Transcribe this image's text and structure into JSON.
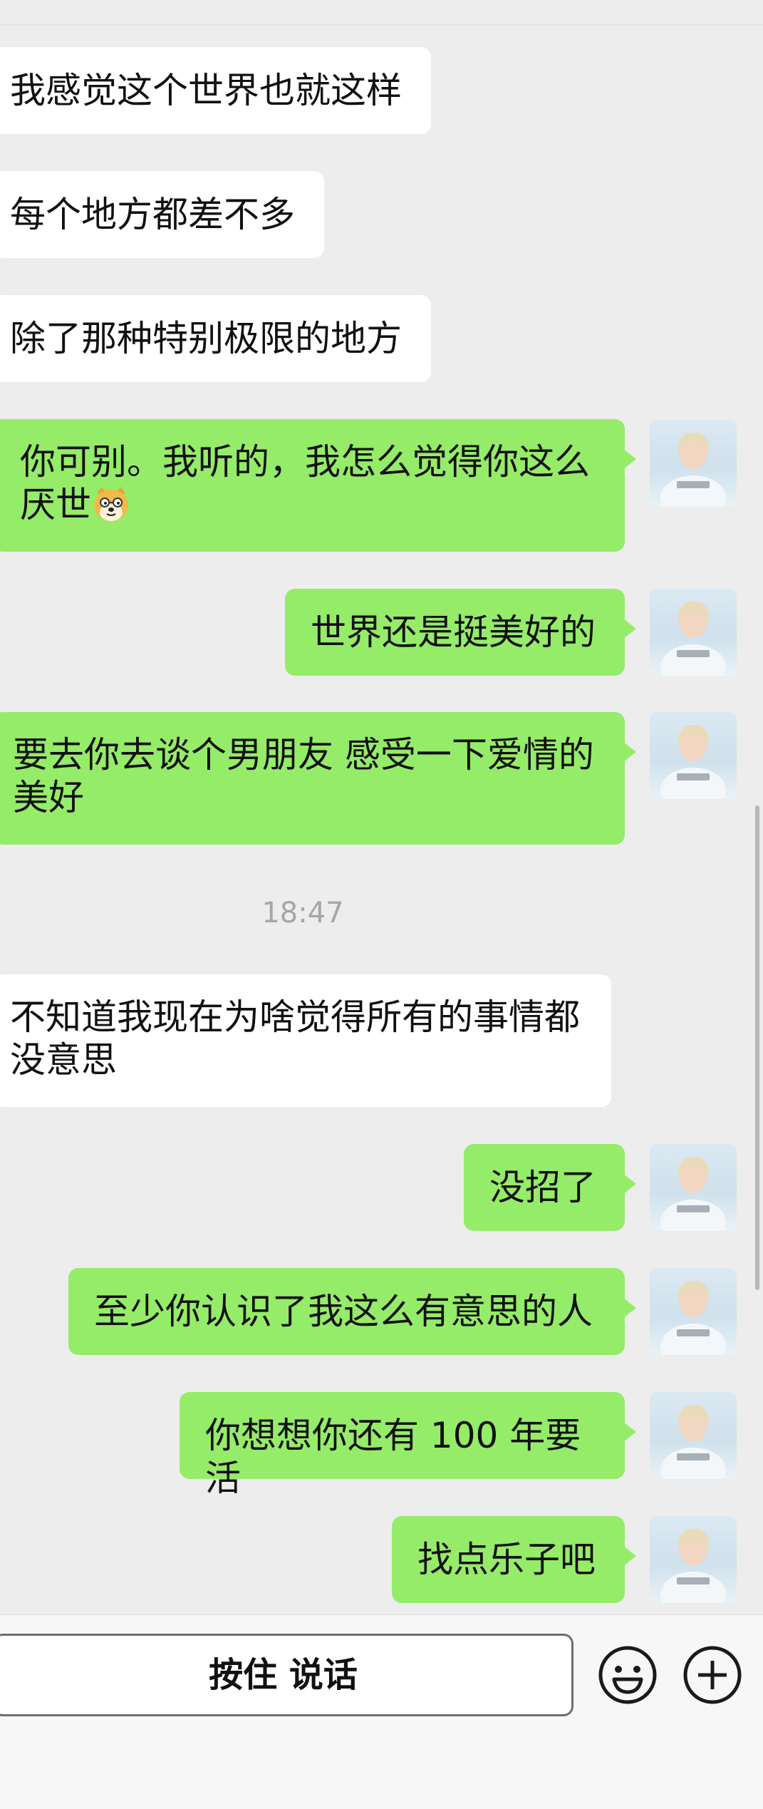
{
  "messages": [
    {
      "side": "in",
      "text": "我感觉这个世界也就这样"
    },
    {
      "side": "in",
      "text": "每个地方都差不多"
    },
    {
      "side": "in",
      "text": "除了那种特别极限的地方"
    },
    {
      "side": "out",
      "line1": "你可别。我听的，我怎么觉得你这么",
      "line2": "厌世",
      "emoji": "doge-emoji"
    },
    {
      "side": "out",
      "text": "世界还是挺美好的"
    },
    {
      "side": "out",
      "line1": "要去你去谈个男朋友 感受一下爱情的",
      "line2": "美好"
    },
    {
      "side": "in",
      "line1": "不知道我现在为啥觉得所有的事情都",
      "line2": "没意思"
    },
    {
      "side": "out",
      "text": "没招了"
    },
    {
      "side": "out",
      "text": "至少你认识了我这么有意思的人"
    },
    {
      "side": "out",
      "text": "你想想你还有 100 年要活"
    },
    {
      "side": "out",
      "text": "找点乐子吧"
    }
  ],
  "timestamp": "18:47",
  "input_bar": {
    "voice_label": "按住 说话",
    "emoji_icon": "smiley-icon",
    "plus_icon": "plus-icon"
  },
  "colors": {
    "background": "#ededed",
    "outgoing_bubble": "#95ec69",
    "incoming_bubble": "#ffffff",
    "timestamp": "#a6a6a6"
  }
}
